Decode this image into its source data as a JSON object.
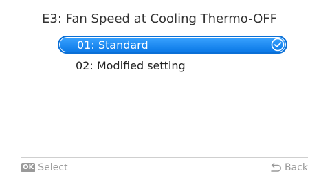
{
  "screen": {
    "title": "E3: Fan Speed at Cooling Thermo-OFF"
  },
  "options": [
    {
      "label": "01: Standard",
      "selected": true
    },
    {
      "label": "02: Modified setting",
      "selected": false
    }
  ],
  "footer": {
    "ok_badge": "OK",
    "select_label": "Select",
    "back_label": "Back",
    "back_icon": "return-arrow-icon"
  },
  "colors": {
    "highlight": "#1a8cff",
    "footer_text": "#9a9a9a"
  }
}
